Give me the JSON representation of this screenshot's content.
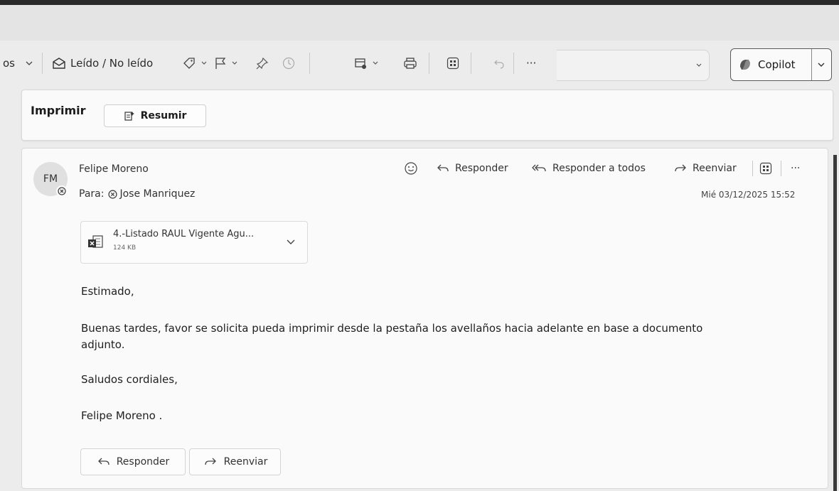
{
  "toolbar": {
    "partial_label": "os",
    "read_unread_label": "Leído / No leído",
    "overflow_label": "···",
    "copilot_label": "Copilot",
    "icons": [
      "envelope-open-icon",
      "tag-icon",
      "flag-icon",
      "pin-icon",
      "clock-icon",
      "rules-icon",
      "print-icon",
      "apps-icon",
      "undo-icon",
      "more-icon"
    ]
  },
  "print_bar": {
    "title": "Imprimir",
    "summarize_label": "Resumir"
  },
  "message": {
    "avatar_initials": "FM",
    "sender": "Felipe Moreno",
    "to_label": "Para:",
    "recipient": "Jose Manriquez",
    "datetime": "Mié 03/12/2025 15:52",
    "actions": {
      "reply": "Responder",
      "reply_all": "Responder a todos",
      "forward": "Reenviar",
      "more": "···"
    },
    "attachment": {
      "name": "4.-Listado RAUL Vigente Agu...",
      "size": "124 KB"
    },
    "body": {
      "greeting": "Estimado,",
      "paragraph_line1": "Buenas tardes, favor se solicita pueda imprimir desde la pestaña los avellaños hacia adelante en base a documento",
      "paragraph_line2": "adjunto.",
      "closing": "Saludos cordiales,",
      "signature": "Felipe Moreno ."
    },
    "footer": {
      "reply": "Responder",
      "forward": "Reenviar"
    }
  },
  "colors": {
    "accent": "#1b1b1b",
    "background": "#fafafa"
  }
}
